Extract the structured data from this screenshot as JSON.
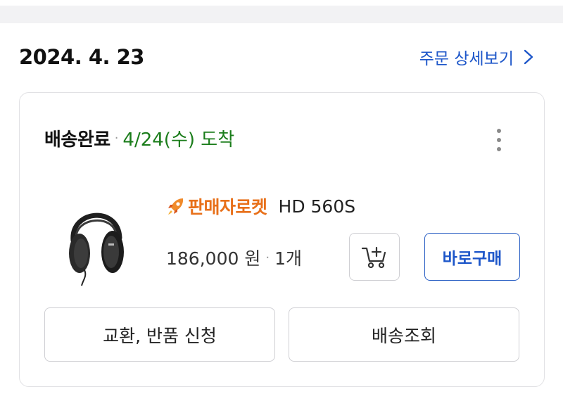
{
  "order": {
    "date": "2024. 4. 23",
    "detail_link": "주문 상세보기"
  },
  "card": {
    "status_label": "배송완료",
    "status_separator": "·",
    "arrival_text": "4/24(수) 도착",
    "product": {
      "badge_label": "판매자로켓",
      "name": "HD 560S",
      "price": "186,000 원",
      "separator": "·",
      "quantity": "1개",
      "image": "headphones"
    },
    "buy_now_label": "바로구매",
    "exchange_return_label": "교환, 반품 신청",
    "tracking_label": "배송조회"
  },
  "icons": {
    "more_menu": "more-vertical-icon",
    "detail_chevron": "chevron-right-icon",
    "badge_icon": "rocket-icon",
    "cart_icon": "add-to-cart-icon"
  },
  "colors": {
    "link_blue": "#1d56c9",
    "arrival_green": "#1b7d1b",
    "rocket_orange": "#e8701a"
  }
}
